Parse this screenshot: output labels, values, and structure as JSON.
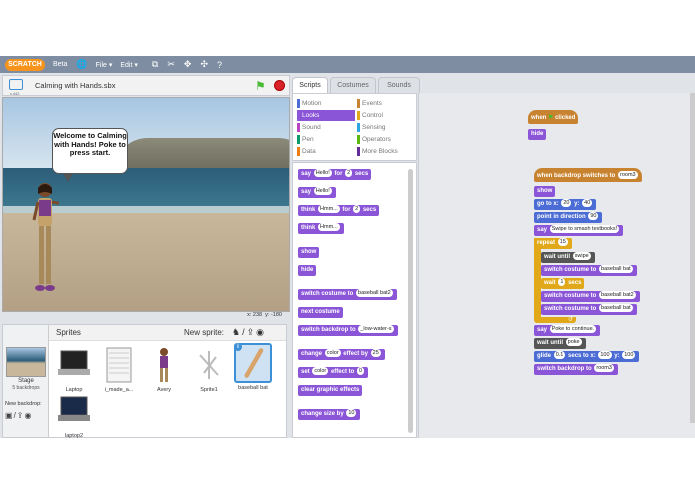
{
  "menubar": {
    "logo": "SCRATCH",
    "beta": "Beta",
    "file": "File ▾",
    "edit": "Edit ▾"
  },
  "stage": {
    "version": "v.442",
    "project_title": "Calming with Hands.sbx",
    "bubble_text": "Welcome to Calming with Hands! Poke to press start.",
    "x_coord": "x: 238",
    "y_coord": "y: -180"
  },
  "sprites_panel": {
    "title": "Sprites",
    "new_sprite": "New sprite:",
    "stage_label": "Stage",
    "stage_backdrops": "5 backdrops",
    "new_backdrop": "New backdrop:",
    "sprites": [
      {
        "name": "Laptop"
      },
      {
        "name": "i_made_a..."
      },
      {
        "name": "Avery"
      },
      {
        "name": "Sprite1"
      },
      {
        "name": "baseball bat",
        "selected": true
      },
      {
        "name": "laptop2"
      }
    ]
  },
  "tabs": {
    "scripts": "Scripts",
    "costumes": "Costumes",
    "sounds": "Sounds"
  },
  "categories": [
    {
      "label": "Motion",
      "color": "#4a6cd4"
    },
    {
      "label": "Events",
      "color": "#c88330"
    },
    {
      "label": "Looks",
      "color": "#8a55d7",
      "active": true
    },
    {
      "label": "Control",
      "color": "#e1a91a"
    },
    {
      "label": "Sound",
      "color": "#bb42c3"
    },
    {
      "label": "Sensing",
      "color": "#2ca5e2"
    },
    {
      "label": "Pen",
      "color": "#0e9a6c"
    },
    {
      "label": "Operators",
      "color": "#5cb712"
    },
    {
      "label": "Data",
      "color": "#ee7d16"
    },
    {
      "label": "More Blocks",
      "color": "#632d99"
    }
  ],
  "palette": {
    "say_for": {
      "a": "say",
      "v1": "Hello!",
      "b": "for",
      "v2": "2",
      "c": "secs"
    },
    "say": {
      "a": "say",
      "v1": "Hello!"
    },
    "think_for": {
      "a": "think",
      "v1": "Hmm...",
      "b": "for",
      "v2": "2",
      "c": "secs"
    },
    "think": {
      "a": "think",
      "v1": "Hmm..."
    },
    "show": "show",
    "hide": "hide",
    "switch_costume": {
      "a": "switch costume to",
      "v1": "baseball bat2"
    },
    "next_costume": "next costume",
    "switch_backdrop": {
      "a": "switch backdrop to",
      "v1": "_low-water-s"
    },
    "change_effect": {
      "a": "change",
      "v1": "color",
      "b": "effect by",
      "v2": "25"
    },
    "set_effect": {
      "a": "set",
      "v1": "color",
      "b": "effect to",
      "v2": "0"
    },
    "clear_effects": "clear graphic effects",
    "change_size": {
      "a": "change size by",
      "v1": "10"
    }
  },
  "scripts": {
    "script1": {
      "when": "when",
      "clicked": "clicked",
      "hide": "hide"
    },
    "script2": {
      "when_backdrop": "when backdrop switches to",
      "backdrop": "room3",
      "show": "show",
      "goto": {
        "a": "go to x:",
        "x": "20",
        "b": "y:",
        "y": "40"
      },
      "point": {
        "a": "point in direction",
        "v": "90"
      },
      "say1": {
        "a": "say",
        "v": "Swipe to smash textbooks!"
      },
      "repeat": {
        "a": "repeat",
        "v": "15"
      },
      "wait_until": {
        "a": "wait until",
        "v": "swipe"
      },
      "switch1": {
        "a": "switch costume to",
        "v": "baseball bat"
      },
      "wait": {
        "a": "wait",
        "v": "1",
        "b": "secs"
      },
      "switch2": {
        "a": "switch costume to",
        "v": "baseball bat2"
      },
      "switch3": {
        "a": "switch costume to",
        "v": "baseball bat"
      },
      "say2": {
        "a": "say",
        "v": "Poke to continue."
      },
      "wait_until2": {
        "a": "wait until",
        "v": "poke"
      },
      "glide": {
        "a": "glide",
        "v1": "0.1",
        "b": "secs to x:",
        "x": "100",
        "c": "y:",
        "y": "100"
      },
      "switch_backdrop": {
        "a": "switch backdrop to",
        "v": "room3"
      }
    }
  }
}
